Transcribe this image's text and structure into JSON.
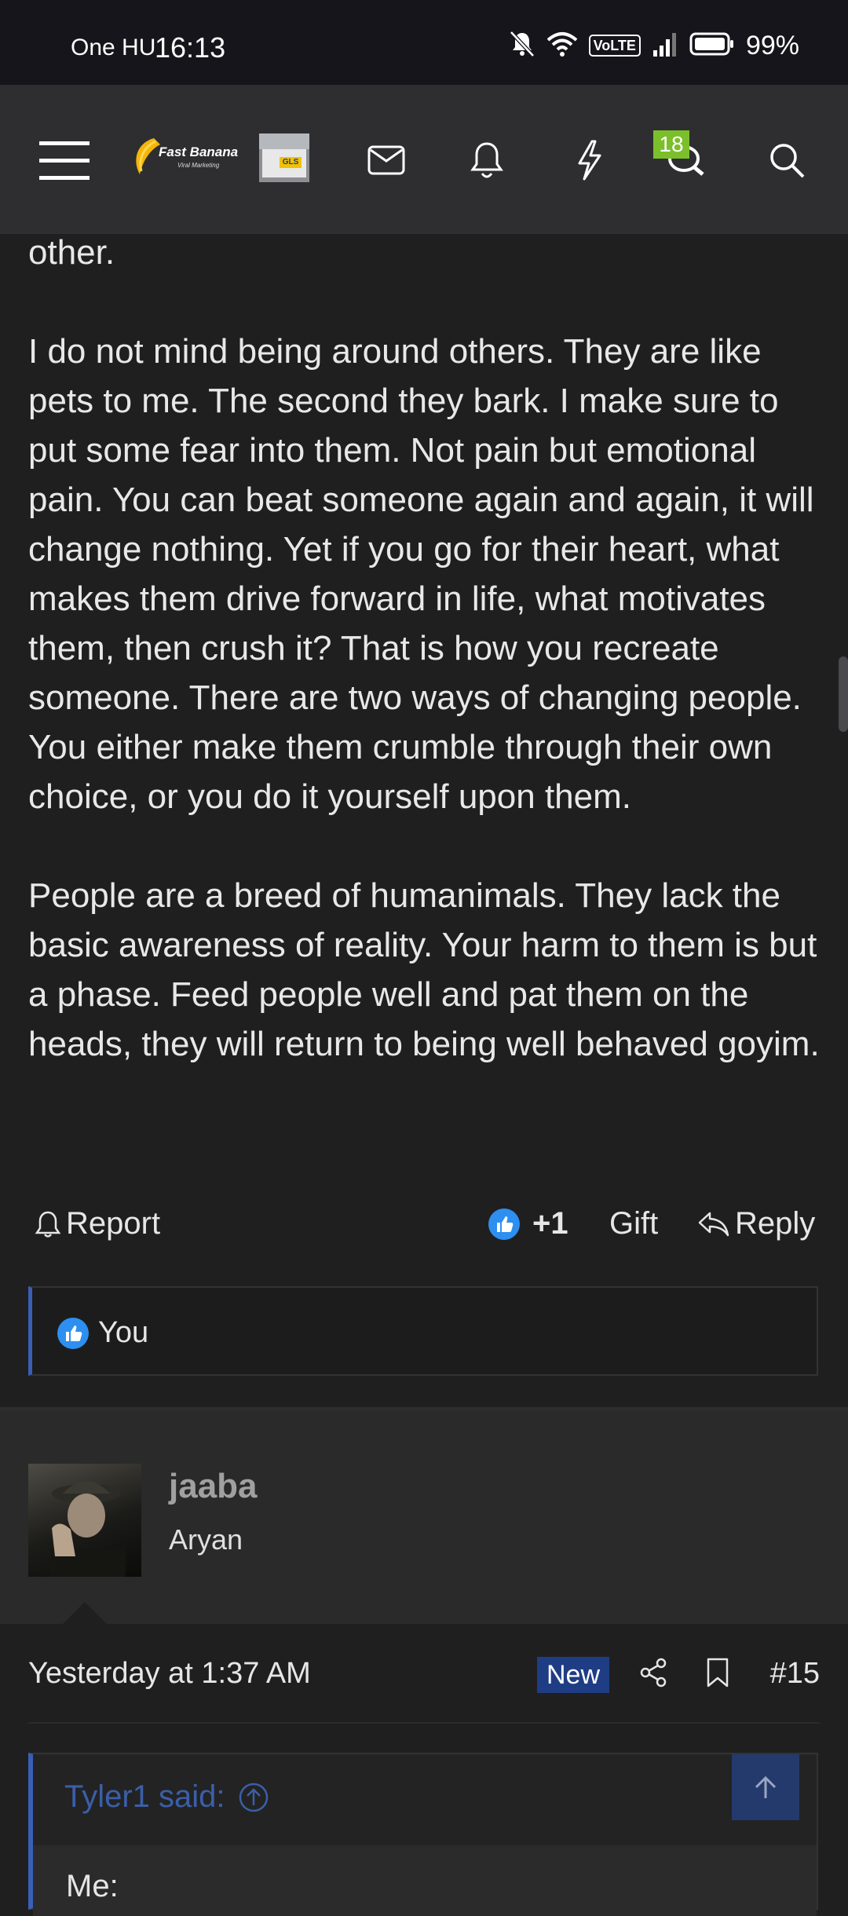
{
  "status_bar": {
    "carrier": "One HU",
    "time": "16:13",
    "volte": "VoLTE",
    "battery": "99%"
  },
  "navbar": {
    "logo_text": "Fast Banana",
    "logo_sub": "Viral Marketing",
    "thumb_label": "GLS",
    "notification_count": "18",
    "icons": [
      "menu-icon",
      "mail-icon",
      "bell-icon",
      "lightning-icon",
      "chat-icon",
      "search-icon"
    ]
  },
  "post": {
    "partial_top": "other.",
    "paragraph_1": "I do not mind being around others. They are like pets to me. The second they bark. I make sure to put some fear into them. Not pain but emotional pain. You can beat someone again and again, it will change nothing. Yet if you go for their heart, what makes them drive forward in life, what motivates them, then crush it? That is how you recreate someone. There are two ways of changing people. You either make them crumble through their own choice, or you do it yourself upon them.",
    "paragraph_2": "People are a breed of humanimals. They lack the basic awareness of reality. Your harm to them is but a phase. Feed people well and pat them on the heads, they will return to being well behaved goyim."
  },
  "actions": {
    "report": "Report",
    "like_count": "+1",
    "gift": "Gift",
    "reply": "Reply"
  },
  "reactions": {
    "label": "You"
  },
  "next_post": {
    "username": "jaaba",
    "user_title": "Aryan",
    "date": "Yesterday at 1:37 AM",
    "new_badge": "New",
    "post_number": "#15",
    "quote_author": "Tyler1 said:",
    "quote_text": "Me:"
  },
  "colors": {
    "background": "#1f1f20",
    "navbar": "#2e2e30",
    "accent_blue": "#3a5fb4",
    "badge_green": "#7bbf2a",
    "like_blue": "#2d8ff0"
  }
}
